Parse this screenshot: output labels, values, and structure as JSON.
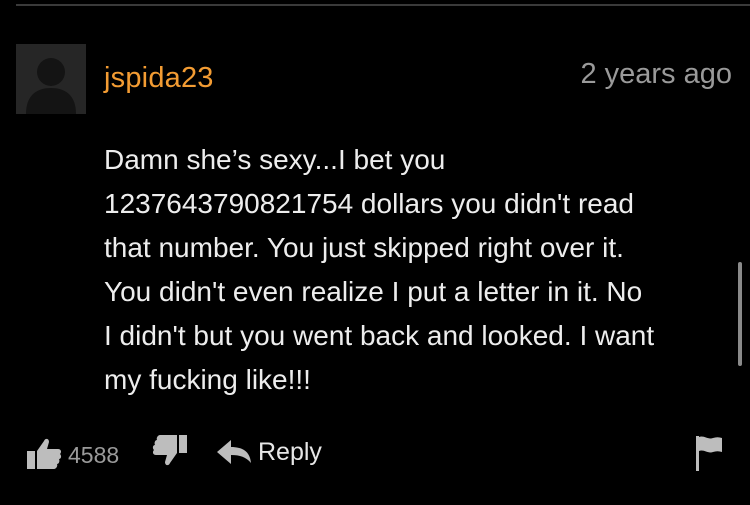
{
  "comment": {
    "username": "jspida23",
    "timestamp": "2 years ago",
    "body": "Damn she’s sexy...I bet you\n1237643790821754 dollars you didn't read\nthat number. You just skipped right over it.\nYou didn't even realize I put a letter in it. No\nI didn't but you went back and looked. I want\nmy fucking like!!!"
  },
  "actions": {
    "like_count": "4588",
    "reply_label": "Reply",
    "icons": {
      "like": "thumbs-up-icon",
      "dislike": "thumbs-down-icon",
      "reply": "reply-arrow-icon",
      "flag": "flag-icon"
    }
  },
  "colors": {
    "background": "#000000",
    "username": "#f39c33",
    "timestamp": "#9a9a9a",
    "body_text": "#ededed",
    "icons": "#bdbdbd"
  }
}
